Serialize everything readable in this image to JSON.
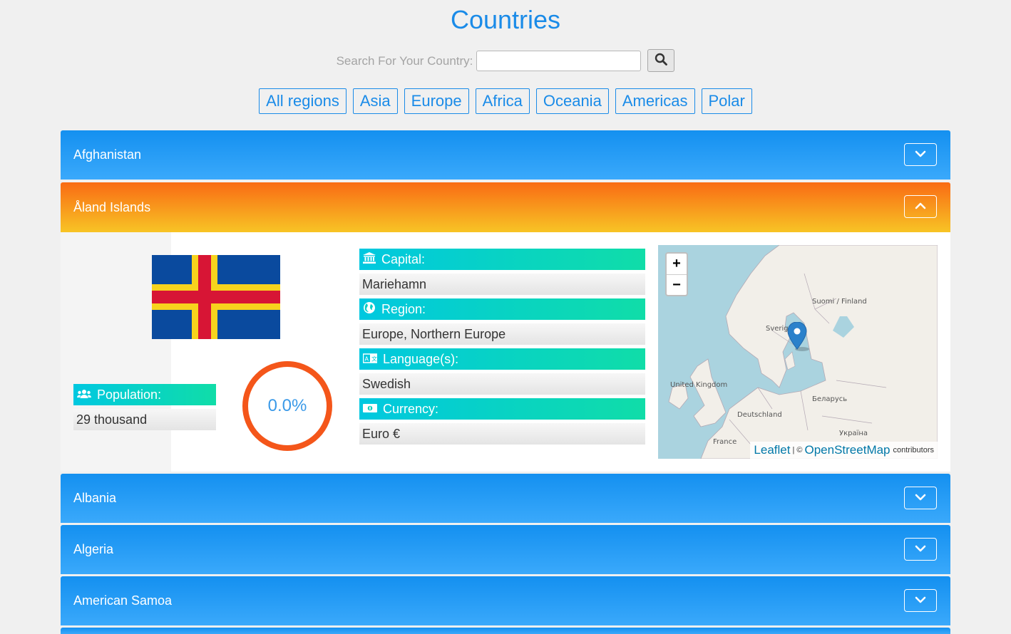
{
  "header": {
    "title": "Countries"
  },
  "search": {
    "label": "Search For Your Country:",
    "value": "",
    "placeholder": ""
  },
  "regions": [
    "All regions",
    "Asia",
    "Europe",
    "Africa",
    "Oceania",
    "Americas",
    "Polar"
  ],
  "countries": [
    {
      "name": "Afghanistan",
      "expanded": false
    },
    {
      "name": "Åland Islands",
      "expanded": true
    },
    {
      "name": "Albania",
      "expanded": false
    },
    {
      "name": "Algeria",
      "expanded": false
    },
    {
      "name": "American Samoa",
      "expanded": false
    }
  ],
  "detail": {
    "population_label": "Population:",
    "population_value": "29 thousand",
    "ring_label": "0.0%",
    "capital_label": "Capital:",
    "capital_value": "Mariehamn",
    "region_label": "Region:",
    "region_value": "Europe, Northern Europe",
    "language_label": "Language(s):",
    "language_value": "Swedish",
    "currency_label": "Currency:",
    "currency_value": "Euro €"
  },
  "map": {
    "zoom_in": "+",
    "zoom_out": "−",
    "attribution_leaflet": "Leaflet",
    "attribution_sep": "| ©",
    "attribution_osm": "OpenStreetMap",
    "attribution_suffix": "contributors",
    "labels": [
      "Suomi / Finland",
      "Sverige",
      "United Kingdom",
      "Беларусь",
      "Deutschland",
      "Україна",
      "France"
    ]
  },
  "colors": {
    "accent": "#1a8be8",
    "panel_closed": "#1490f0",
    "panel_open": "#f96b14",
    "info_head": "#00c8e0",
    "ring": "#f4561a"
  }
}
